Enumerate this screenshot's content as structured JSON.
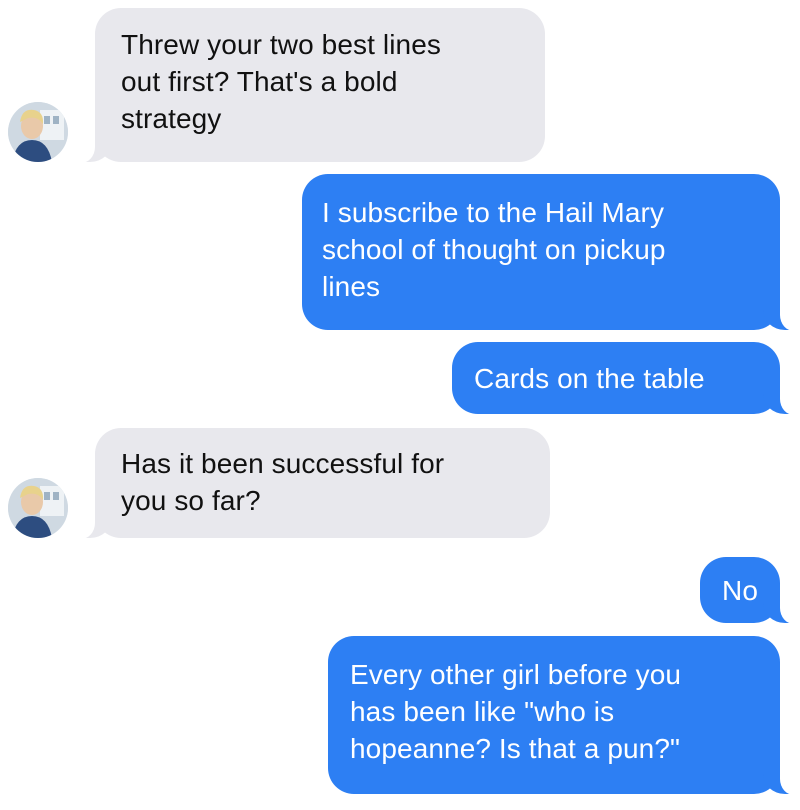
{
  "conversation": {
    "messages": [
      {
        "side": "received",
        "text": "Threw your two best lines\nout first? That's a bold\nstrategy"
      },
      {
        "side": "sent",
        "text": "I subscribe to the Hail Mary\nschool of thought on pickup\nlines"
      },
      {
        "side": "sent",
        "text": "Cards on the table"
      },
      {
        "side": "received",
        "text": "Has it been successful for\nyou so far?"
      },
      {
        "side": "sent",
        "text": "No"
      },
      {
        "side": "sent",
        "text": "Every other girl before you\nhas been like \"who is\nhopeanne? Is that a pun?\""
      }
    ]
  },
  "colors": {
    "sent_bubble": "#2d7ff3",
    "received_bubble": "#e8e8ed",
    "background": "#ffffff"
  }
}
